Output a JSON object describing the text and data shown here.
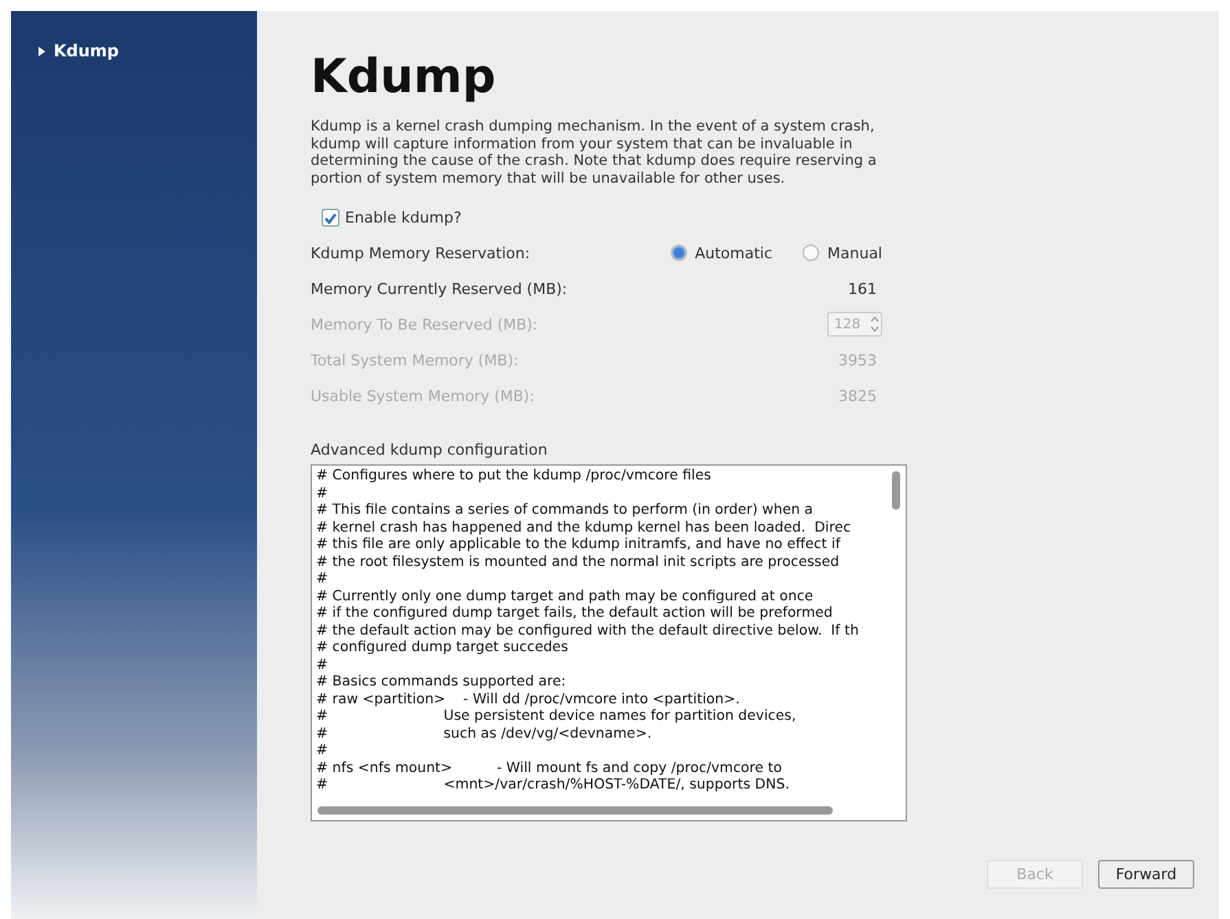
{
  "sidebar": {
    "items": [
      {
        "label": "Kdump",
        "selected": true
      }
    ]
  },
  "title": "Kdump",
  "description": "Kdump is a kernel crash dumping mechanism. In the event of a system crash, kdump will capture information from your system that can be invaluable in determining the cause of the crash. Note that kdump does require reserving a portion of system memory that will be unavailable for other uses.",
  "enable": {
    "label": "Enable kdump?",
    "checked": true
  },
  "rows": [
    {
      "kind": "radio",
      "label": "Kdump Memory Reservation:",
      "disabled": false,
      "options": [
        {
          "label": "Automatic",
          "selected": true
        },
        {
          "label": "Manual",
          "selected": false
        }
      ]
    },
    {
      "kind": "value",
      "label": "Memory Currently Reserved (MB):",
      "disabled": false,
      "value": "161"
    },
    {
      "kind": "spin",
      "label": "Memory To Be Reserved (MB):",
      "disabled": true,
      "value": "128"
    },
    {
      "kind": "value",
      "label": "Total System Memory (MB):",
      "disabled": true,
      "value": "3953"
    },
    {
      "kind": "value",
      "label": "Usable System Memory (MB):",
      "disabled": true,
      "value": "3825"
    }
  ],
  "config": {
    "label": "Advanced kdump configuration",
    "lines": [
      "# Configures where to put the kdump /proc/vmcore files",
      "#",
      "# This file contains a series of commands to perform (in order) when a",
      "# kernel crash has happened and the kdump kernel has been loaded.  Direc",
      "# this file are only applicable to the kdump initramfs, and have no effect if",
      "# the root filesystem is mounted and the normal init scripts are processed",
      "#",
      "# Currently only one dump target and path may be configured at once",
      "# if the configured dump target fails, the default action will be preformed",
      "# the default action may be configured with the default directive below.  If th",
      "# configured dump target succedes",
      "#",
      "# Basics commands supported are:",
      "# raw <partition>    - Will dd /proc/vmcore into <partition>.",
      "#                          Use persistent device names for partition devices,",
      "#                          such as /dev/vg/<devname>.",
      "#",
      "# nfs <nfs mount>          - Will mount fs and copy /proc/vmcore to",
      "#                          <mnt>/var/crash/%HOST-%DATE/, supports DNS."
    ]
  },
  "buttons": [
    {
      "label": "Back",
      "disabled": true
    },
    {
      "label": "Forward",
      "disabled": false
    }
  ]
}
